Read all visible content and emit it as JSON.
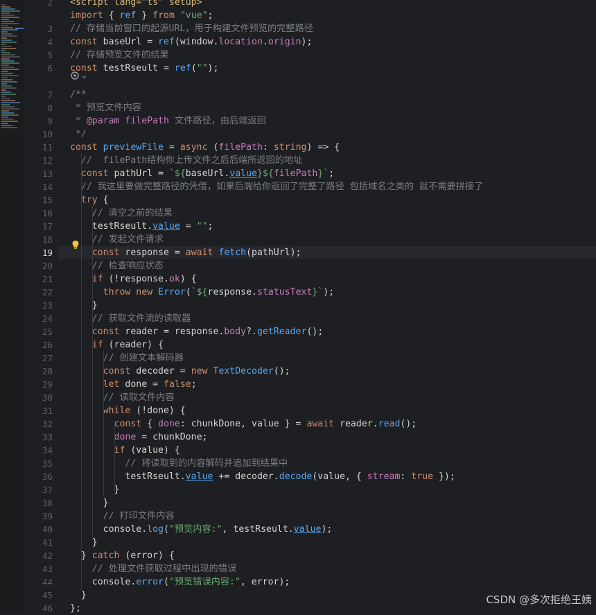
{
  "editor": {
    "current_line": "19",
    "lines": [
      {
        "n": "2",
        "tokens": [
          [
            "tag",
            "<script lang=\"ts\" setup>"
          ]
        ]
      },
      {
        "n": "",
        "tokens": [
          [
            "kw",
            "import"
          ],
          [
            "var",
            " { "
          ],
          [
            "fn",
            "ref"
          ],
          [
            "var",
            " } "
          ],
          [
            "kw",
            "from"
          ],
          [
            "str",
            " \"vue\""
          ],
          [
            "var",
            ";"
          ]
        ]
      },
      {
        "n": "3",
        "tokens": [
          [
            "com",
            "// 存储当前窗口的起源URL，用于构建文件预览的完整路径"
          ]
        ]
      },
      {
        "n": "4",
        "tokens": [
          [
            "kw",
            "const "
          ],
          [
            "var",
            "baseUrl"
          ],
          [
            "var",
            " = "
          ],
          [
            "fn",
            "ref"
          ],
          [
            "var",
            "("
          ],
          [
            "var",
            "window"
          ],
          [
            "var",
            "."
          ],
          [
            "prop",
            "location"
          ],
          [
            "var",
            "."
          ],
          [
            "prop",
            "origin"
          ],
          [
            "var",
            ");"
          ]
        ]
      },
      {
        "n": "5",
        "tokens": [
          [
            "com",
            "// 存储预览文件的结果"
          ]
        ]
      },
      {
        "n": "6",
        "tokens": [
          [
            "kw",
            "const "
          ],
          [
            "var",
            "testRseult"
          ],
          [
            "var",
            " = "
          ],
          [
            "fn",
            "ref"
          ],
          [
            "var",
            "("
          ],
          [
            "str",
            "\"\""
          ],
          [
            "var",
            ");"
          ]
        ]
      },
      {
        "n": "",
        "tokens": []
      },
      {
        "n": "7",
        "tokens": [
          [
            "com",
            "/**"
          ]
        ]
      },
      {
        "n": "8",
        "tokens": [
          [
            "com",
            " * 预览文件内容"
          ]
        ]
      },
      {
        "n": "9",
        "tokens": [
          [
            "com",
            " * "
          ],
          [
            "kw2",
            "@param"
          ],
          [
            "com",
            " "
          ],
          [
            "prop",
            "filePath"
          ],
          [
            "com",
            " 文件路径，由后端返回"
          ]
        ]
      },
      {
        "n": "10",
        "tokens": [
          [
            "com",
            " */"
          ]
        ]
      },
      {
        "n": "11",
        "tokens": [
          [
            "kw",
            "const "
          ],
          [
            "fn",
            "previewFile"
          ],
          [
            "var",
            " = "
          ],
          [
            "kw",
            "async "
          ],
          [
            "var",
            "("
          ],
          [
            "prop",
            "filePath"
          ],
          [
            "var",
            ": "
          ],
          [
            "kw",
            "string"
          ],
          [
            "var",
            ") => {"
          ]
        ]
      },
      {
        "n": "12",
        "tokens": [
          [
            "com",
            "  //  filePath结构你上传文件之后后端所返回的地址"
          ]
        ]
      },
      {
        "n": "13",
        "tokens": [
          [
            "kw",
            "  const "
          ],
          [
            "var",
            "pathUrl"
          ],
          [
            "var",
            " = "
          ],
          [
            "str",
            "`${"
          ],
          [
            "var",
            "baseUrl."
          ],
          [
            "fn u",
            "value"
          ],
          [
            "str",
            "}${"
          ],
          [
            "prop",
            "filePath"
          ],
          [
            "str",
            "}`"
          ],
          [
            "var",
            ";"
          ]
        ]
      },
      {
        "n": "14",
        "tokens": [
          [
            "com",
            "  // 我这里要做完整路径的凭借，如果后端给你返回了完整了路径 包括域名之类的 就不需要拼接了"
          ]
        ]
      },
      {
        "n": "15",
        "tokens": [
          [
            "kw",
            "  try "
          ],
          [
            "var",
            "{"
          ]
        ]
      },
      {
        "n": "16",
        "tokens": [
          [
            "com",
            "    // 清空之前的结果"
          ]
        ]
      },
      {
        "n": "17",
        "tokens": [
          [
            "var",
            "    testRseult."
          ],
          [
            "fn u",
            "value"
          ],
          [
            "var",
            " = "
          ],
          [
            "str",
            "\"\""
          ],
          [
            "var",
            ";"
          ]
        ]
      },
      {
        "n": "18",
        "tokens": [
          [
            "com",
            "    // 发起文件请求"
          ]
        ]
      },
      {
        "n": "19",
        "tokens": [
          [
            "kw",
            "    const "
          ],
          [
            "var",
            "response"
          ],
          [
            "var",
            " = "
          ],
          [
            "kw",
            "await "
          ],
          [
            "fn",
            "fetch"
          ],
          [
            "var",
            "(pathUrl);"
          ]
        ]
      },
      {
        "n": "20",
        "tokens": [
          [
            "com",
            "    // 检查响应状态"
          ]
        ]
      },
      {
        "n": "21",
        "tokens": [
          [
            "kw",
            "    if "
          ],
          [
            "var",
            "(!response."
          ],
          [
            "prop",
            "ok"
          ],
          [
            "var",
            ") {"
          ]
        ]
      },
      {
        "n": "22",
        "tokens": [
          [
            "kw",
            "      throw new "
          ],
          [
            "fn",
            "Error"
          ],
          [
            "var",
            "("
          ],
          [
            "str",
            "`${"
          ],
          [
            "var",
            "response."
          ],
          [
            "prop",
            "statusText"
          ],
          [
            "str",
            "}`"
          ],
          [
            "var",
            ");"
          ]
        ]
      },
      {
        "n": "23",
        "tokens": [
          [
            "var",
            "    }"
          ]
        ]
      },
      {
        "n": "24",
        "tokens": [
          [
            "com",
            "    // 获取文件流的读取器"
          ]
        ]
      },
      {
        "n": "25",
        "tokens": [
          [
            "kw",
            "    const "
          ],
          [
            "var",
            "reader"
          ],
          [
            "var",
            " = response."
          ],
          [
            "prop",
            "body"
          ],
          [
            "var",
            "?."
          ],
          [
            "fn",
            "getReader"
          ],
          [
            "var",
            "();"
          ]
        ]
      },
      {
        "n": "26",
        "tokens": [
          [
            "kw",
            "    if "
          ],
          [
            "var",
            "(reader) {"
          ]
        ]
      },
      {
        "n": "27",
        "tokens": [
          [
            "com",
            "      // 创建文本解码器"
          ]
        ]
      },
      {
        "n": "28",
        "tokens": [
          [
            "kw",
            "      const "
          ],
          [
            "var",
            "decoder"
          ],
          [
            "var",
            " = "
          ],
          [
            "kw",
            "new "
          ],
          [
            "fn",
            "TextDecoder"
          ],
          [
            "var",
            "();"
          ]
        ]
      },
      {
        "n": "29",
        "tokens": [
          [
            "kw",
            "      let "
          ],
          [
            "var",
            "done"
          ],
          [
            "var",
            " = "
          ],
          [
            "kw",
            "false"
          ],
          [
            "var",
            ";"
          ]
        ]
      },
      {
        "n": "30",
        "tokens": [
          [
            "com",
            "      // 读取文件内容"
          ]
        ]
      },
      {
        "n": "31",
        "tokens": [
          [
            "kw",
            "      while "
          ],
          [
            "var",
            "(!done) {"
          ]
        ]
      },
      {
        "n": "32",
        "tokens": [
          [
            "kw",
            "        const "
          ],
          [
            "var",
            "{ "
          ],
          [
            "prop",
            "done"
          ],
          [
            "var",
            ": chunkDone, value } = "
          ],
          [
            "kw",
            "await "
          ],
          [
            "var",
            "reader."
          ],
          [
            "fn",
            "read"
          ],
          [
            "var",
            "();"
          ]
        ]
      },
      {
        "n": "33",
        "tokens": [
          [
            "prop",
            "        done"
          ],
          [
            "var",
            " = chunkDone;"
          ]
        ]
      },
      {
        "n": "34",
        "tokens": [
          [
            "kw",
            "        if "
          ],
          [
            "var",
            "(value) {"
          ]
        ]
      },
      {
        "n": "35",
        "tokens": [
          [
            "com",
            "          // 将读取到的内容解码并追加到结果中"
          ]
        ]
      },
      {
        "n": "36",
        "tokens": [
          [
            "var",
            "          testRseult."
          ],
          [
            "fn u",
            "value"
          ],
          [
            "var",
            " += decoder."
          ],
          [
            "fn",
            "decode"
          ],
          [
            "var",
            "(value, { "
          ],
          [
            "prop",
            "stream"
          ],
          [
            "var",
            ": "
          ],
          [
            "kw",
            "true"
          ],
          [
            "var",
            " });"
          ]
        ]
      },
      {
        "n": "37",
        "tokens": [
          [
            "var",
            "        }"
          ]
        ]
      },
      {
        "n": "38",
        "tokens": [
          [
            "var",
            "      }"
          ]
        ]
      },
      {
        "n": "39",
        "tokens": [
          [
            "com",
            "      // 打印文件内容"
          ]
        ]
      },
      {
        "n": "40",
        "tokens": [
          [
            "var",
            "      console."
          ],
          [
            "fn",
            "log"
          ],
          [
            "var",
            "("
          ],
          [
            "str",
            "\"预览内容:\""
          ],
          [
            "var",
            ", testRseult."
          ],
          [
            "fn u",
            "value"
          ],
          [
            "var",
            ");"
          ]
        ]
      },
      {
        "n": "41",
        "tokens": [
          [
            "var",
            "    }"
          ]
        ]
      },
      {
        "n": "42",
        "tokens": [
          [
            "var",
            "  } "
          ],
          [
            "kw",
            "catch "
          ],
          [
            "var",
            "(error) {"
          ]
        ]
      },
      {
        "n": "43",
        "tokens": [
          [
            "com",
            "    // 处理文件获取过程中出现的错误"
          ]
        ]
      },
      {
        "n": "44",
        "tokens": [
          [
            "var",
            "    console."
          ],
          [
            "fn",
            "error"
          ],
          [
            "var",
            "("
          ],
          [
            "str",
            "\"预览错误内容:\""
          ],
          [
            "var",
            ", error);"
          ]
        ]
      },
      {
        "n": "45",
        "tokens": [
          [
            "var",
            "  }"
          ]
        ]
      },
      {
        "n": "46",
        "tokens": [
          [
            "var",
            "};"
          ]
        ]
      }
    ]
  },
  "fold_hint": "⌄",
  "watermark": "CSDN @多次拒绝王姨",
  "colors": {
    "background": "#1e1f22",
    "keyword": "#cf8e6d",
    "string": "#6aab73",
    "function": "#56a8f5",
    "property": "#c77dbb",
    "comment": "#7a7e85",
    "text": "#bcbec4"
  },
  "icons": {
    "bulb": "lightbulb-icon",
    "ai": "ai-assistant-icon"
  }
}
